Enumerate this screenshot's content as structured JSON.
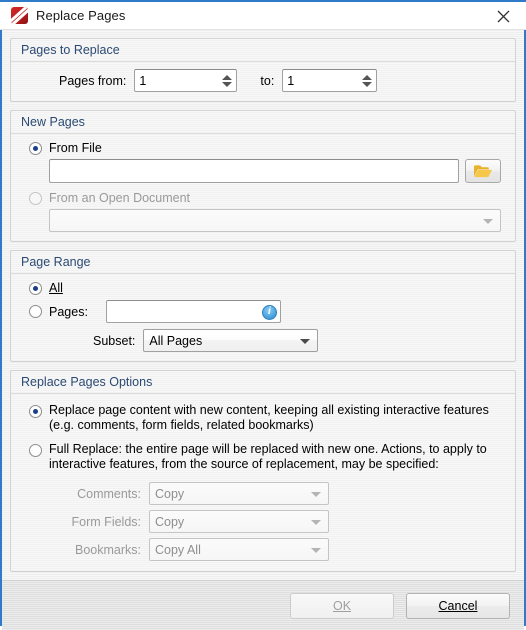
{
  "window": {
    "title": "Replace Pages",
    "app_icon": "pdf-xchange-logo-icon",
    "close_icon": "close-icon",
    "accent_color": "#2f7ac9",
    "group_title_color": "#2b4a73"
  },
  "pages_to_replace": {
    "group_title": "Pages to Replace",
    "from_label": "Pages from:",
    "from_value": "1",
    "to_label": "to:",
    "to_value": "1",
    "spinner_up_icon": "spinner-up-icon",
    "spinner_down_icon": "spinner-down-icon"
  },
  "new_pages": {
    "group_title": "New Pages",
    "from_file": {
      "label": "From File",
      "selected": true,
      "path_value": "",
      "browse_icon": "open-folder-icon"
    },
    "from_open_document": {
      "label": "From an Open Document",
      "selected": false,
      "disabled": true,
      "value": "",
      "arrow_icon": "chevron-down-icon"
    }
  },
  "page_range": {
    "group_title": "Page Range",
    "all": {
      "label": "All",
      "accel": "A",
      "selected": true
    },
    "pages": {
      "label": "Pages:",
      "accel": "g",
      "selected": false,
      "value": "",
      "info_icon": "info-icon",
      "info_glyph": "i"
    },
    "subset": {
      "label": "Subset:",
      "value": "All Pages",
      "arrow_icon": "chevron-down-icon"
    }
  },
  "replace_options": {
    "group_title": "Replace Pages Options",
    "keep_interactive": {
      "selected": true,
      "line1": "Replace page content with new content, keeping all existing interactive features",
      "line2": "(e.g. comments, form fields, related bookmarks)"
    },
    "full_replace": {
      "selected": false,
      "line1": "Full Replace: the entire page will be replaced with new one. Actions, to apply to",
      "line2": "interactive features, from the source of replacement, may be specified:"
    },
    "fields": [
      {
        "label": "Comments:",
        "value": "Copy",
        "disabled": true,
        "arrow_icon": "chevron-down-icon"
      },
      {
        "label": "Form Fields:",
        "value": "Copy",
        "disabled": true,
        "arrow_icon": "chevron-down-icon"
      },
      {
        "label": "Bookmarks:",
        "value": "Copy All",
        "disabled": true,
        "arrow_icon": "chevron-down-icon"
      }
    ]
  },
  "footer": {
    "ok": {
      "label": "OK",
      "accel": "O",
      "disabled": true
    },
    "cancel": {
      "label": "Cancel",
      "accel": "C",
      "disabled": false
    }
  }
}
